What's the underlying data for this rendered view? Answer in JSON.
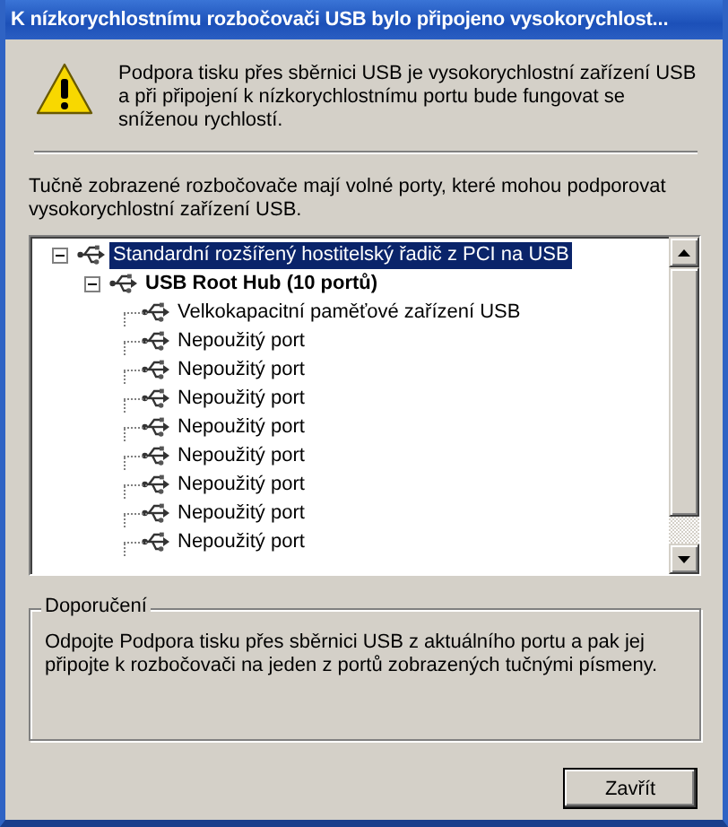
{
  "window": {
    "title": "K nízkorychlostnímu rozbočovači USB bylo připojeno vysokorychlost..."
  },
  "warning": {
    "text": "Podpora tisku přes sběrnici USB je vysokorychlostní zařízení USB a při připojení k nízkorychlostnímu portu bude fungovat se sníženou rychlostí."
  },
  "hint": "Tučně zobrazené rozbočovače mají volné porty, které mohou podporovat vysokorychlostní zařízení USB.",
  "tree": [
    {
      "label": "Standardní rozšířený hostitelský řadič z PCI na USB",
      "bold": false,
      "selected": true,
      "expanded": true,
      "children": [
        {
          "label": "USB Root Hub (10 portů)",
          "bold": true,
          "selected": false,
          "expanded": true,
          "children": [
            {
              "label": "Velkokapacitní paměťové zařízení USB",
              "bold": false,
              "selected": false
            },
            {
              "label": "Nepoužitý port",
              "bold": false,
              "selected": false
            },
            {
              "label": "Nepoužitý port",
              "bold": false,
              "selected": false
            },
            {
              "label": "Nepoužitý port",
              "bold": false,
              "selected": false
            },
            {
              "label": "Nepoužitý port",
              "bold": false,
              "selected": false
            },
            {
              "label": "Nepoužitý port",
              "bold": false,
              "selected": false
            },
            {
              "label": "Nepoužitý port",
              "bold": false,
              "selected": false
            },
            {
              "label": "Nepoužitý port",
              "bold": false,
              "selected": false
            },
            {
              "label": "Nepoužitý port",
              "bold": false,
              "selected": false
            }
          ]
        }
      ]
    }
  ],
  "recommendation": {
    "title": "Doporučení",
    "text": "Odpojte Podpora tisku přes sběrnici USB z aktuálního portu a pak jej připojte k rozbočovači na jeden z portů zobrazených tučnými písmeny."
  },
  "buttons": [
    "Zavřít"
  ]
}
